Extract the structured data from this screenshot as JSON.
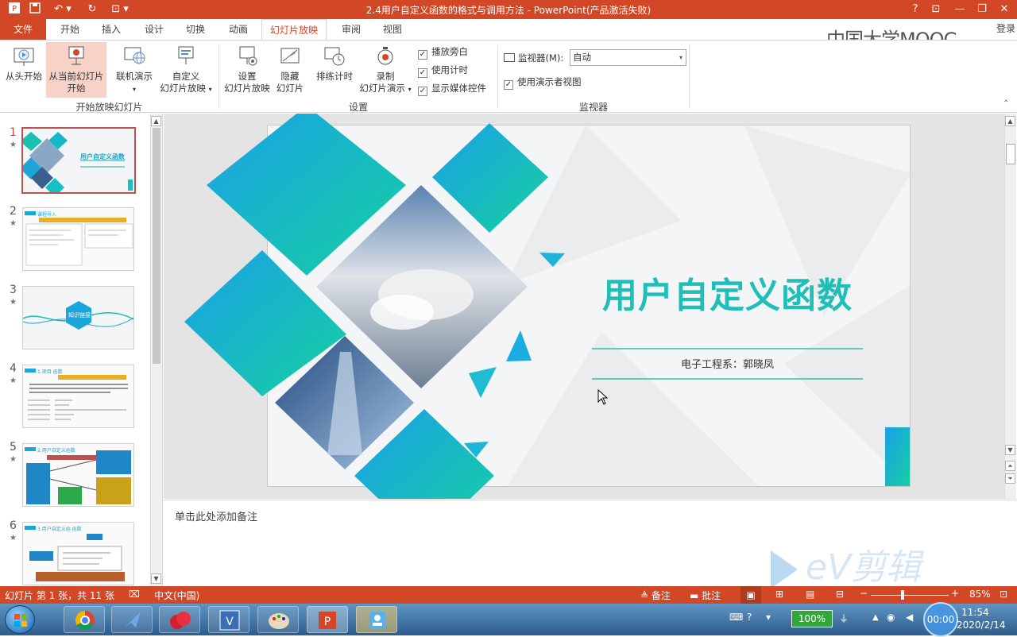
{
  "window": {
    "title": "2.4用户自定义函数的格式与调用方法 - PowerPoint(产品激活失败)",
    "help": "?",
    "login": "登录"
  },
  "tabs": [
    "文件",
    "开始",
    "插入",
    "设计",
    "切换",
    "动画",
    "幻灯片放映",
    "审阅",
    "视图"
  ],
  "ribbon": {
    "from_beginning": "从头开始",
    "from_current_1": "从当前幻灯片",
    "from_current_2": "开始",
    "online_present": "联机演示",
    "custom_1": "自定义",
    "custom_2": "幻灯片放映",
    "group_start": "开始放映幻灯片",
    "setup_1": "设置",
    "setup_2": "幻灯片放映",
    "hide_1": "隐藏",
    "hide_2": "幻灯片",
    "rehearse": "排练计时",
    "record_1": "录制",
    "record_2": "幻灯片演示",
    "chk_narration": "播放旁白",
    "chk_timings": "使用计时",
    "chk_media": "显示媒体控件",
    "group_setup": "设置",
    "monitor_label": "监视器(M):",
    "monitor_value": "自动",
    "chk_presenter": "使用演示者视图",
    "group_monitor": "监视器"
  },
  "watermark_top": "中国大学MOOC",
  "thumbs": [
    {
      "num": "1",
      "title": "用户自定义函数"
    },
    {
      "num": "2",
      "title": "课程导入"
    },
    {
      "num": "3",
      "title": "知识链接"
    },
    {
      "num": "4",
      "title": "1.项目 函数"
    },
    {
      "num": "5",
      "title": "2.用户自定义函数"
    },
    {
      "num": "6",
      "title": "3.用户自定义函 函数"
    }
  ],
  "slide": {
    "title": "用户自定义函数",
    "subtitle": "电子工程系：郭晓凤"
  },
  "notes_placeholder": "单击此处添加备注",
  "watermark_bottom": "eV剪辑",
  "status": {
    "slide_info": "幻灯片 第 1 张，共 11 张",
    "language": "中文(中国)",
    "notes": "备注",
    "comments": "批注",
    "zoom": "85%"
  },
  "taskbar": {
    "battery": "100%",
    "time": "11:54",
    "date": "2020/2/14",
    "overlay": "00:00"
  },
  "colors": {
    "accent": "#d24726",
    "teal": "#14c0b0",
    "blue": "#1aa0e0"
  }
}
